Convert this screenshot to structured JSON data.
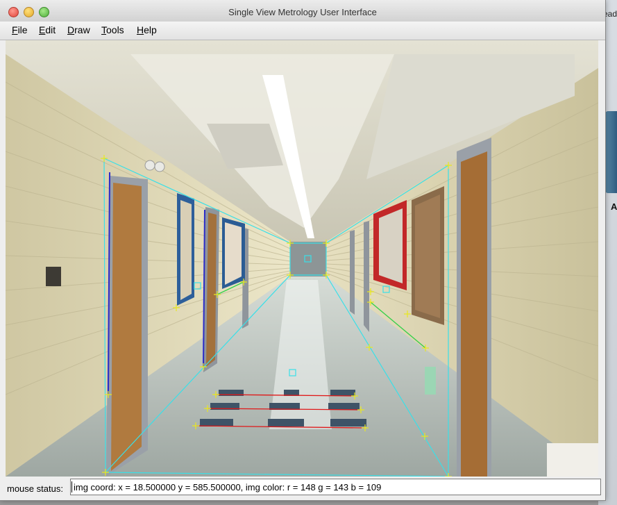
{
  "window": {
    "title": "Single View Metrology User Interface"
  },
  "menu": {
    "items": [
      {
        "label": "File",
        "mnemonic": "F",
        "rest": "ile"
      },
      {
        "label": "Edit",
        "mnemonic": "E",
        "rest": "dit"
      },
      {
        "label": "Draw",
        "mnemonic": "D",
        "rest": "raw"
      },
      {
        "label": "Tools",
        "mnemonic": "T",
        "rest": "ools"
      },
      {
        "label": "Help",
        "mnemonic": "H",
        "rest": "elp"
      }
    ]
  },
  "status": {
    "label": "mouse status:",
    "value": "img coord: x = 18.500000 y = 585.500000, img color: r = 148 g = 143 b = 109"
  },
  "desktop": {
    "top_label": "ead",
    "bottom_label": "A"
  },
  "colors": {
    "wall": "#d9d2b0",
    "floor": "#b7c0bd",
    "ceiling": "#dcd9c8",
    "door": "#b07a3f",
    "frame_line": "#39e0e8",
    "vertical_line": "#2a2ac8",
    "green_line": "#35d04a",
    "red_line": "#e01818",
    "marker": "#e8e820"
  }
}
